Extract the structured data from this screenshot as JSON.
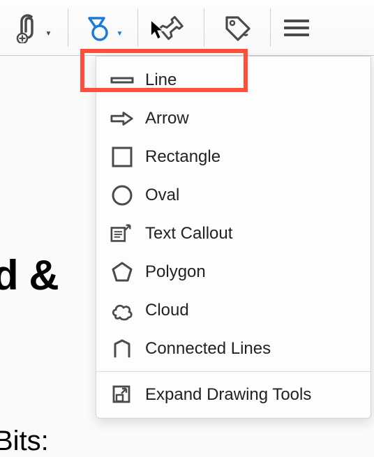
{
  "toolbar": {
    "attach": "attach",
    "shapes": "shapes",
    "pin": "pin",
    "tag": "tag",
    "more": "more"
  },
  "menu": {
    "items": [
      {
        "label": "Line",
        "icon": "line"
      },
      {
        "label": "Arrow",
        "icon": "arrow"
      },
      {
        "label": "Rectangle",
        "icon": "rectangle"
      },
      {
        "label": "Oval",
        "icon": "oval"
      },
      {
        "label": "Text Callout",
        "icon": "text-callout"
      },
      {
        "label": "Polygon",
        "icon": "polygon"
      },
      {
        "label": "Cloud",
        "icon": "cloud"
      },
      {
        "label": "Connected Lines",
        "icon": "connected-lines"
      }
    ],
    "footer": {
      "label": "Expand Drawing Tools",
      "icon": "expand"
    }
  },
  "background": {
    "text1": "d &",
    "text2": "Bits:"
  }
}
